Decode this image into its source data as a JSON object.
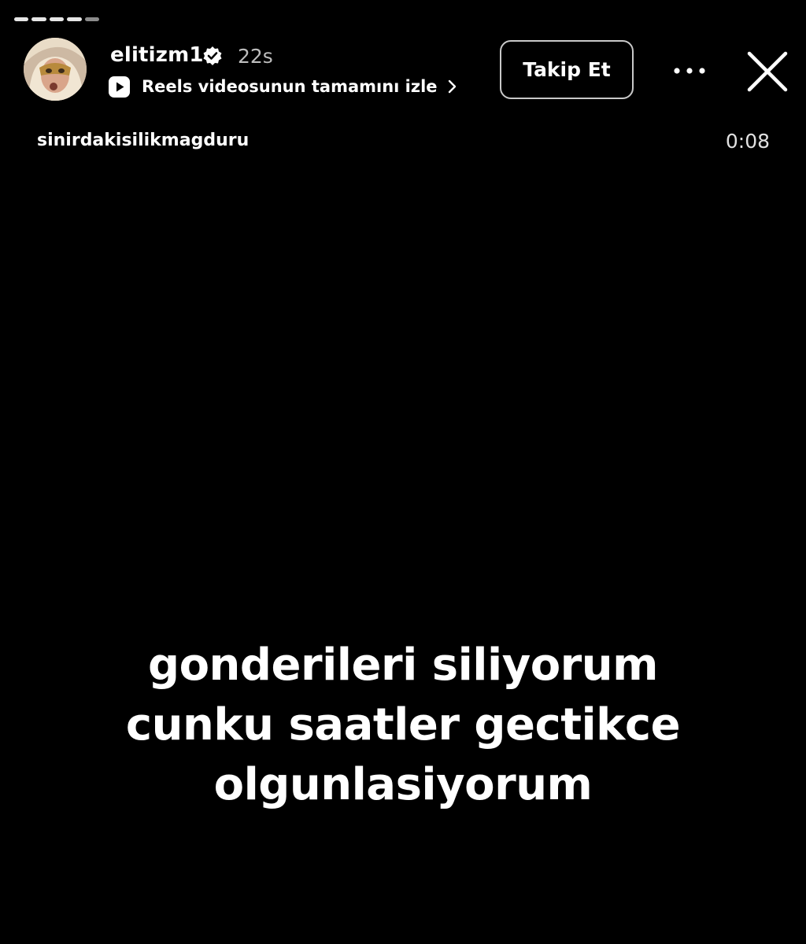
{
  "story": {
    "progress": {
      "segments": 5,
      "completed": 4
    },
    "header": {
      "username": "elitizm1",
      "verified": true,
      "time_ago": "22s",
      "reels_link_label": "Reels videosunun tamamını izle",
      "follow_label": "Takip Et",
      "more_icon": "more-horizontal-icon",
      "close_icon": "close-icon"
    },
    "audio": {
      "name": "sinirdakisilikmagduru",
      "duration": "0:08"
    },
    "caption": {
      "lines": [
        "gonderileri siliyorum",
        "cunku saatler gectikce",
        "olgunlasiyorum"
      ]
    }
  },
  "colors": {
    "background": "#000000",
    "text": "#ffffff",
    "muted": "#bdbdbd"
  }
}
